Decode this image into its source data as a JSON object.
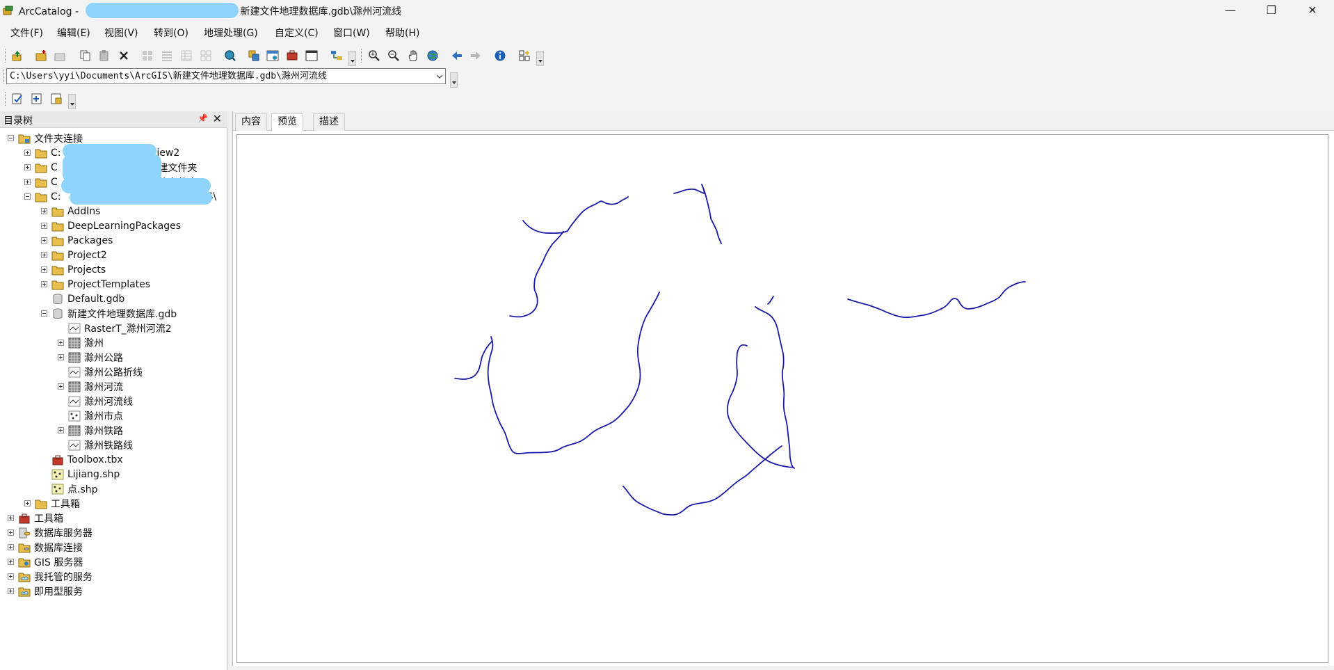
{
  "window": {
    "app_name": "ArcCatalog - ",
    "path_suffix": "新建文件地理数据库.gdb\\滁州河流线",
    "minimize": "—",
    "restore": "❐",
    "close": "✕"
  },
  "menu": [
    "文件(F)",
    "编辑(E)",
    "视图(V)",
    "转到(O)",
    "地理处理(G)",
    "自定义(C)",
    "窗口(W)",
    "帮助(H)"
  ],
  "address": {
    "value": "C:\\Users\\yyi\\Documents\\ArcGIS\\新建文件地理数据库.gdb\\滁州河流线"
  },
  "catalog_tree": {
    "title": "目录树",
    "pin": "📌",
    "close": "✕",
    "items": [
      {
        "label": "文件夹连接"
      },
      {
        "label": "C:"
      },
      {
        "label": "p\\view2"
      },
      {
        "label": "C"
      },
      {
        "label": "\\新建文件夹"
      },
      {
        "label": "C"
      },
      {
        "label": "\\新建文件夹\\"
      },
      {
        "label": "C:"
      },
      {
        "label": "S\\"
      },
      {
        "label": "AddIns"
      },
      {
        "label": "DeepLearningPackages"
      },
      {
        "label": "Packages"
      },
      {
        "label": "Project2"
      },
      {
        "label": "Projects"
      },
      {
        "label": "ProjectTemplates"
      },
      {
        "label": "Default.gdb"
      },
      {
        "label": "新建文件地理数据库.gdb"
      },
      {
        "label": "RasterT_滁州河流2"
      },
      {
        "label": "滁州"
      },
      {
        "label": "滁州公路"
      },
      {
        "label": "滁州公路折线"
      },
      {
        "label": "滁州河流"
      },
      {
        "label": "滁州河流线"
      },
      {
        "label": "滁州市点"
      },
      {
        "label": "滁州铁路"
      },
      {
        "label": "滁州铁路线"
      },
      {
        "label": "Toolbox.tbx"
      },
      {
        "label": "Lijiang.shp"
      },
      {
        "label": "点.shp"
      },
      {
        "label": "工具箱"
      },
      {
        "label": "工具箱"
      },
      {
        "label": "数据库服务器"
      },
      {
        "label": "数据库连接"
      },
      {
        "label": "GIS 服务器"
      },
      {
        "label": "我托管的服务"
      },
      {
        "label": "即用型服务"
      }
    ]
  },
  "tabs": [
    "内容",
    "预览",
    "描述"
  ],
  "colors": {
    "river_line": "#1a1aa8",
    "redaction": "#8fd4fb"
  }
}
